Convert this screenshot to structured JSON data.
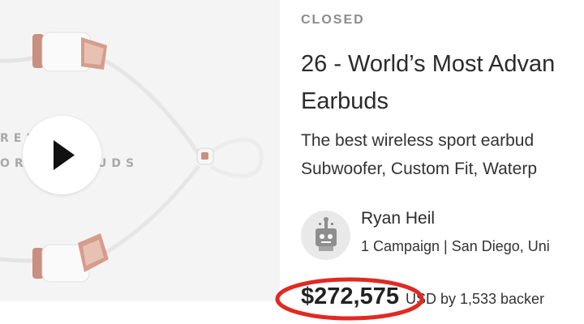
{
  "media": {
    "bg_text_line1": "REM",
    "bg_text_line2": "OR",
    "bg_text_line3": "UDS",
    "play_icon": "play-icon"
  },
  "campaign": {
    "status": "CLOSED",
    "title_line1": "26 - World’s Most Advan",
    "title_line2": "Earbuds",
    "blurb_line1": "The best wireless sport earbud",
    "blurb_line2": "Subwoofer, Custom Fit, Waterp"
  },
  "creator": {
    "avatar_icon": "robot-avatar-icon",
    "name": "Ryan Heil",
    "meta": "1 Campaign | San Diego, Uni"
  },
  "funding": {
    "amount": "$272,575",
    "backers": "USD by 1,533 backer"
  },
  "colors": {
    "highlight": "#e02a22",
    "earbud_copper": "#c98f7f",
    "cable": "#e9e9e9"
  }
}
